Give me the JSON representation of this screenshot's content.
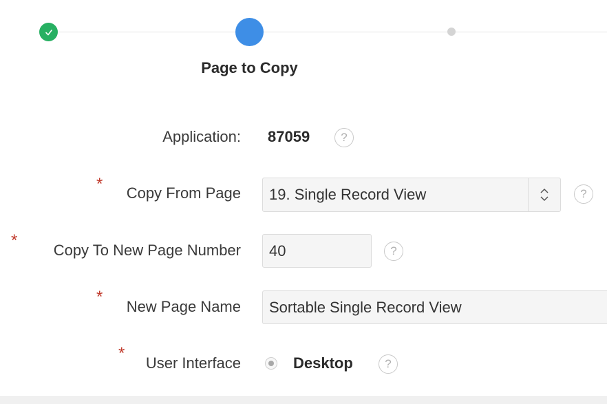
{
  "wizard": {
    "current_step_title": "Page to Copy",
    "complete_color": "#27b062",
    "current_color": "#3e8ee6",
    "future_color": "#d4d4d4"
  },
  "form": {
    "application": {
      "label": "Application:",
      "value": "87059",
      "help_glyph": "?"
    },
    "copy_from_page": {
      "label": "Copy From Page",
      "required_mark": "*",
      "value": "19. Single Record View",
      "help_glyph": "?"
    },
    "copy_to_page_number": {
      "label": "Copy To New Page Number",
      "required_mark": "*",
      "value": "40",
      "help_glyph": "?"
    },
    "new_page_name": {
      "label": "New Page Name",
      "required_mark": "*",
      "value": "Sortable Single Record View"
    },
    "user_interface": {
      "label": "User Interface",
      "required_mark": "*",
      "option": "Desktop",
      "help_glyph": "?"
    }
  },
  "icons": {
    "step_complete": "check-icon",
    "select_arrows": "up-down-chevron-icon",
    "help": "help-icon"
  },
  "colors": {
    "required": "#c0392b"
  }
}
